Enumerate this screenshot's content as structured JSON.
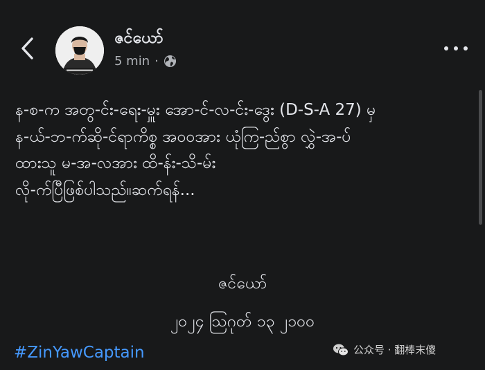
{
  "post": {
    "author": "ဇင်ယော်",
    "time": "5 min",
    "separator": "·",
    "privacy_icon": "globe-icon",
    "back_icon": "chevron-left-icon",
    "more_icon": "more-horizontal-icon",
    "body_lines": [
      "န-စ-က အတွ-င်း-ရေး-မှူး အော-င်-လ-င်း-ဒွေး (D-S-A 27) မှ",
      "န-ယ်-ဘ-က်ဆို-င်ရာကိစ္စ အ၀၀အား ယုံကြ-ည်စွာ လွှဲ-အ-ပ်",
      "ထားသူ မ-အ-လအား ထိ-န်း-သိ-မ်း",
      "လို-က်ပြီဖြစ်ပါသည်။"
    ],
    "see_more": "ဆက်ရန်...",
    "signature_name": "ဇင်ယော်",
    "signature_date": "၂၀၂၄ သြဂုတ် ၁၃ ၂၁၀၀",
    "hashtag": "#ZinYawCaptain"
  },
  "watermark": {
    "icon": "wechat-icon",
    "text": "公众号 · 翻棒末傻"
  },
  "colors": {
    "background": "#18191a",
    "text": "#e4e6eb",
    "secondary": "#b0b3b8",
    "link": "#4599ff"
  }
}
